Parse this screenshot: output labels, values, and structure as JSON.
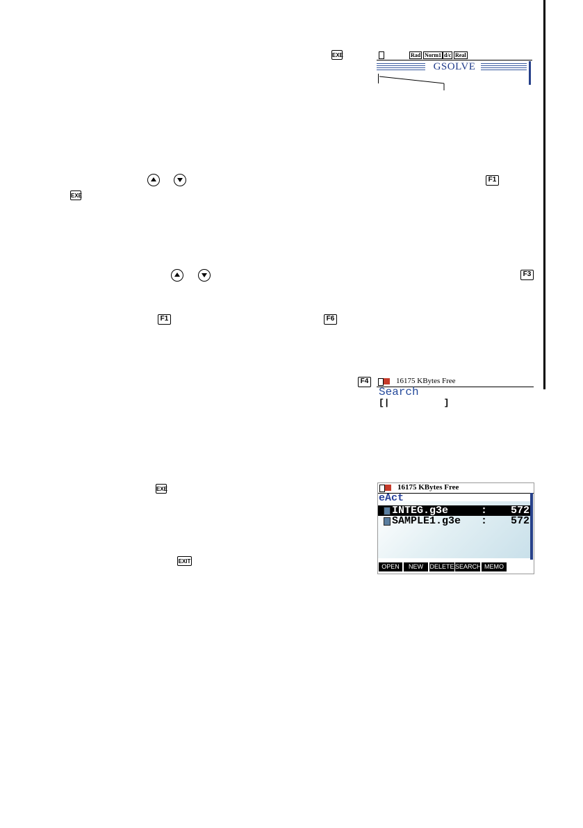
{
  "keys": {
    "exe": "EXE",
    "f1": "F1",
    "f3": "F3",
    "f4": "F4",
    "f6": "F6",
    "exit": "EXIT",
    "up_arrow_icon": "up-arrow",
    "down_arrow_icon": "down-arrow"
  },
  "screen_gsolve": {
    "indicators": [
      "Rad",
      "Norm1",
      "d/c",
      "Real"
    ],
    "title": "GSOLVE"
  },
  "screen_search": {
    "free_memory": "16175 KBytes Free",
    "title": "Search",
    "field": "[|          ]"
  },
  "screen_files": {
    "free_memory": "16175 KBytes Free",
    "folder": "eAct",
    "files": [
      {
        "name": "INTEG.g3e",
        "colon": ":",
        "size": "572",
        "selected": true
      },
      {
        "name": "SAMPLE1.g3e",
        "colon": ":",
        "size": "572",
        "selected": false
      }
    ],
    "function_keys": [
      "OPEN",
      "NEW",
      "DELETE",
      "SEARCH",
      "MEMO"
    ]
  }
}
